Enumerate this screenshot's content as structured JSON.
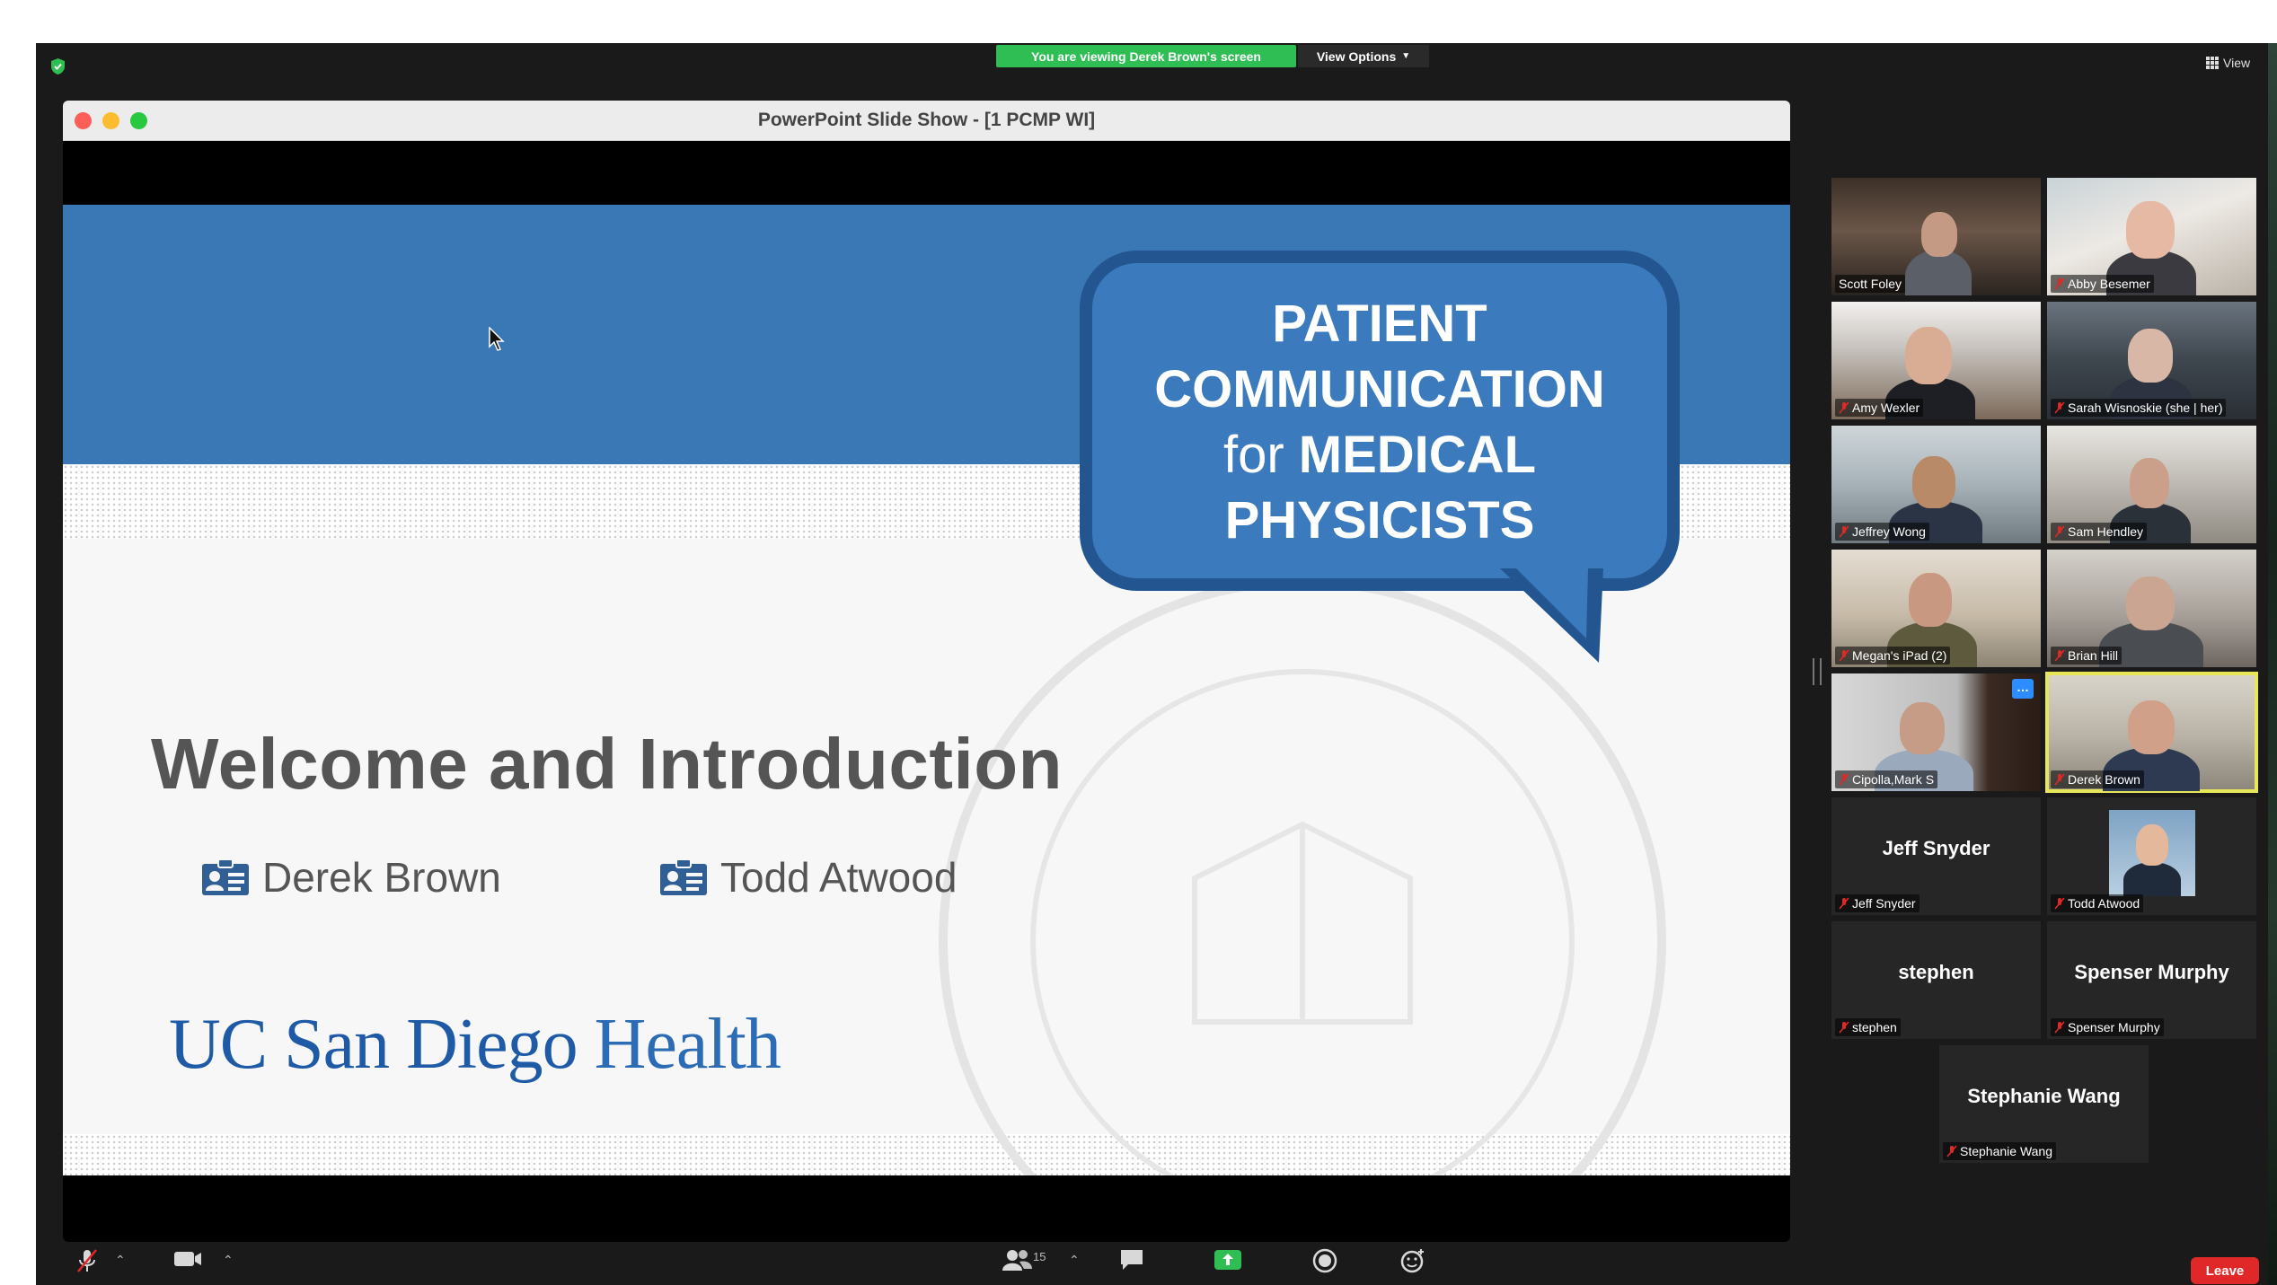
{
  "meeting": {
    "banner": "You are viewing Derek Brown's screen",
    "view_options": "View Options",
    "view_button": "View"
  },
  "window": {
    "title": "PowerPoint Slide Show - [1 PCMP WI]"
  },
  "slide": {
    "bubble_line1": "PATIENT",
    "bubble_line2": "COMMUNICATION",
    "bubble_for": "for",
    "bubble_line3b": "MEDICAL",
    "bubble_line4": "PHYSICISTS",
    "heading": "Welcome and Introduction",
    "presenters": [
      "Derek Brown",
      "Todd Atwood"
    ],
    "logo_part1": "UC San Diego",
    "logo_part2": "Health"
  },
  "gallery": {
    "participants": [
      {
        "label": "Scott Foley",
        "muted": false,
        "video": true
      },
      {
        "label": "Abby Besemer",
        "muted": true,
        "video": true
      },
      {
        "label": "Amy Wexler",
        "muted": true,
        "video": true
      },
      {
        "label": "Sarah Wisnoskie (she | her)",
        "muted": true,
        "video": true
      },
      {
        "label": "Jeffrey Wong",
        "muted": true,
        "video": true
      },
      {
        "label": "Sam Hendley",
        "muted": true,
        "video": true
      },
      {
        "label": "Megan's iPad (2)",
        "muted": true,
        "video": true
      },
      {
        "label": "Brian Hill",
        "muted": true,
        "video": true
      },
      {
        "label": "Cipolla,Mark S",
        "muted": true,
        "video": true
      },
      {
        "label": "Derek Brown",
        "muted": true,
        "video": true,
        "active_speaker": true
      },
      {
        "label": "Jeff Snyder",
        "big_name": "Jeff Snyder",
        "muted": true,
        "video": false
      },
      {
        "label": "Todd Atwood",
        "muted": true,
        "video": false,
        "photo": true
      },
      {
        "label": "stephen",
        "big_name": "stephen",
        "muted": true,
        "video": false
      },
      {
        "label": "Spenser Murphy",
        "big_name": "Spenser Murphy",
        "muted": true,
        "video": false
      },
      {
        "label": "Stephanie Wang",
        "big_name": "Stephanie Wang",
        "muted": true,
        "video": false
      }
    ],
    "more_button": "…"
  },
  "toolbar": {
    "participant_count": "15",
    "leave": "Leave"
  },
  "colors": {
    "banner_green": "#2fbe54",
    "slide_blue": "#3a78b5",
    "bubble_blue": "#3b7abd",
    "bubble_border": "#235690",
    "leave_red": "#e02828",
    "active_speaker": "#e8e75a"
  }
}
